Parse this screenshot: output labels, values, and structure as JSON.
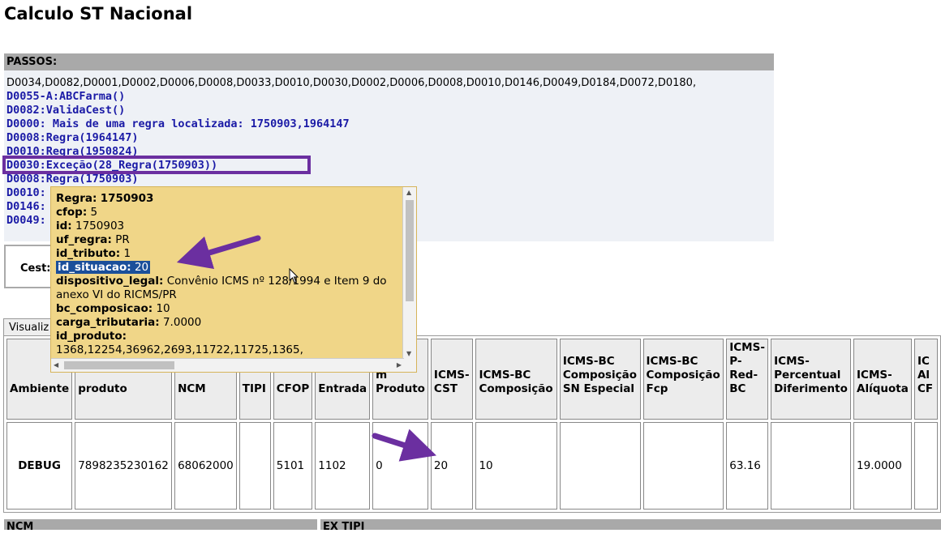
{
  "page": {
    "title": "Calculo ST Nacional"
  },
  "passos": {
    "header": "PASSOS:",
    "lines": [
      {
        "text": "D0034,D0082,D0001,D0002,D0006,D0008,D0033,D0010,D0030,D0002,D0006,D0008,D0010,D0146,D0049,D0184,D0072,D0180,",
        "style": "plain"
      },
      {
        "text": "D0055-A:ABCFarma()",
        "style": "blue"
      },
      {
        "text": "D0082:ValidaCest()",
        "style": "blue"
      },
      {
        "text": "D0000: Mais de uma regra localizada: 1750903,1964147",
        "style": "blue"
      },
      {
        "text": "D0008:Regra(1964147)",
        "style": "blue"
      },
      {
        "text": "D0010:Regra(1950824)",
        "style": "blue"
      },
      {
        "text": "D0030:Exceção(28_Regra(1750903))",
        "style": "blue"
      },
      {
        "text": "D0008:Regra(1750903)",
        "style": "blue"
      },
      {
        "text": "D0010:",
        "style": "blue"
      },
      {
        "text": "D0146:",
        "style": "blue"
      },
      {
        "text": "D0049:",
        "style": "blue"
      }
    ]
  },
  "cest": {
    "label": "Cest:"
  },
  "tab": {
    "label": "Visualiz"
  },
  "tooltip": {
    "regra_label": "Regra:",
    "regra_value": "1750903",
    "cfop_label": "cfop:",
    "cfop_value": "5",
    "id_label": "id:",
    "id_value": "1750903",
    "uf_regra_label": "uf_regra:",
    "uf_regra_value": "PR",
    "id_tributo_label": "id_tributo:",
    "id_tributo_value": "1",
    "id_situacao_label": "id_situacao:",
    "id_situacao_value": "20",
    "dispositivo_label": "dispositivo_legal:",
    "dispositivo_value": "Convênio ICMS nº 128/1994 e Item 9 do anexo VI do RICMS/PR",
    "bc_composicao_label": "bc_composicao:",
    "bc_composicao_value": "10",
    "carga_label": "carga_tributaria:",
    "carga_value": "7.0000",
    "id_produto_label": "id_produto:",
    "id_produto_value": "1368,12254,36962,2693,11722,11725,1365,"
  },
  "table": {
    "headers": [
      "Ambiente",
      "produto",
      "NCM",
      "TIPI",
      "CFOP",
      "Entrada",
      "m Produto",
      "ICMS-CST",
      "ICMS-BC Composição",
      "ICMS-BC Composição SN Especial",
      "ICMS-BC Composição Fcp",
      "ICMS-P-Red-BC",
      "ICMS-Percentual Diferimento",
      "ICMS-Alíquota",
      "IC Al CF"
    ],
    "row": [
      "DEBUG",
      "7898235230162",
      "68062000",
      "",
      "5101",
      "1102",
      "0",
      "20",
      "10",
      "",
      "",
      "63.16",
      "",
      "19.0000",
      ""
    ]
  },
  "bottom": {
    "ncm_label": "NCM",
    "ex_tipi_label": "EX TIPI"
  },
  "annotation_color": "#6b2fa0",
  "icons": [
    "mouse-cursor-icon",
    "annotation-arrow-icon"
  ]
}
